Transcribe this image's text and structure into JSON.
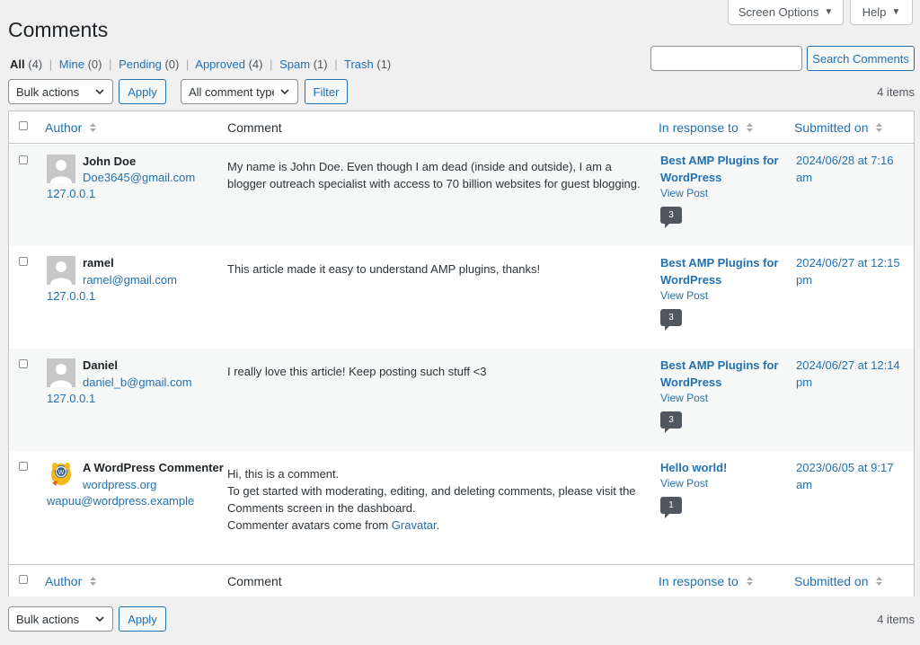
{
  "top_buttons": {
    "screen_options": "Screen Options",
    "help": "Help",
    "caret": "▼"
  },
  "page_title": "Comments",
  "filters": [
    {
      "label": "All",
      "count": "(4)"
    },
    {
      "label": "Mine",
      "count": "(0)"
    },
    {
      "label": "Pending",
      "count": "(0)"
    },
    {
      "label": "Approved",
      "count": "(4)"
    },
    {
      "label": "Spam",
      "count": "(1)"
    },
    {
      "label": "Trash",
      "count": "(1)"
    }
  ],
  "separator": "|",
  "search": {
    "button": "Search Comments",
    "value": ""
  },
  "tablenav_top": {
    "bulk_actions": "Bulk actions",
    "apply": "Apply",
    "comment_type": "All comment types",
    "filter": "Filter",
    "items": "4 items"
  },
  "columns": {
    "author": "Author",
    "comment": "Comment",
    "in_response_to": "In response to",
    "submitted_on": "Submitted on"
  },
  "comments": [
    {
      "author": "John Doe",
      "email": "Doe3645@gmail.com",
      "ip": "127.0.0.1",
      "text": [
        "My name is John Doe. Even though I am dead (inside and outside), I am a blogger outreach specialist with access to 70 billion websites for guest blogging."
      ],
      "post": "Best AMP Plugins for WordPress",
      "view_post": "View Post",
      "count": "3",
      "submitted": "2024/06/28 at 7:16 am"
    },
    {
      "author": "ramel",
      "email": "ramel@gmail.com",
      "ip": "127.0.0.1",
      "text": [
        "This article made it easy to understand AMP plugins, thanks!"
      ],
      "post": "Best AMP Plugins for WordPress",
      "view_post": "View Post",
      "count": "3",
      "submitted": "2024/06/27 at 12:15 pm"
    },
    {
      "author": "Daniel",
      "email": "daniel_b@gmail.com",
      "ip": "127.0.0.1",
      "text": [
        "I really love this article! Keep posting such stuff <3"
      ],
      "post": "Best AMP Plugins for WordPress",
      "view_post": "View Post",
      "count": "3",
      "submitted": "2024/06/27 at 12:14 pm"
    },
    {
      "author": "A WordPress Commenter",
      "url": "wordpress.org",
      "email": "wapuu@wordpress.example",
      "text_lines": [
        "Hi, this is a comment.",
        "To get started with moderating, editing, and deleting comments, please visit the Comments screen in the dashboard.",
        "Commenter avatars come from"
      ],
      "gravatar_link": "Gravatar",
      "gravatar_period": ".",
      "post": "Hello world!",
      "view_post": "View Post",
      "count": "1",
      "submitted": "2023/06/05 at 9:17 am"
    }
  ],
  "tablenav_bottom": {
    "bulk_actions": "Bulk actions",
    "apply": "Apply",
    "items": "4 items"
  }
}
